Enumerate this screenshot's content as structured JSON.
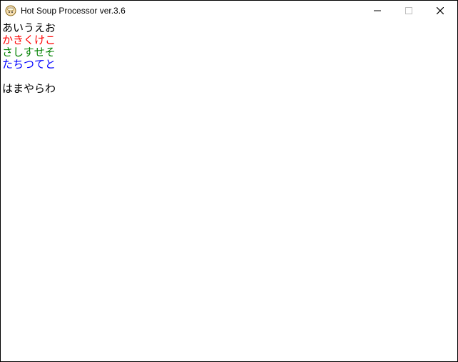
{
  "window": {
    "title": "Hot Soup Processor ver.3.6"
  },
  "content": {
    "lines": [
      {
        "text": "あいうえお",
        "color": "#000000"
      },
      {
        "text": "かきくけこ",
        "color": "#ff0000"
      },
      {
        "text": "さしすせそ",
        "color": "#008000"
      },
      {
        "text": "たちつてと",
        "color": "#0000ff"
      },
      {
        "text": "",
        "color": "#000000"
      },
      {
        "text": "はまやらわ",
        "color": "#000000"
      }
    ]
  }
}
